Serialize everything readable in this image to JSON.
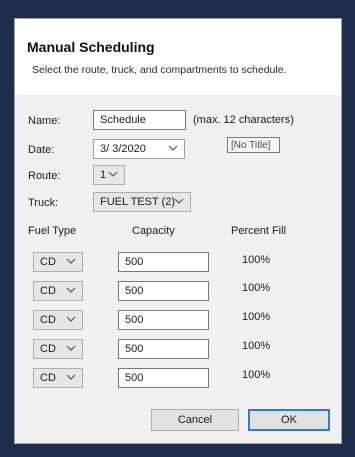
{
  "header": {
    "title": "Manual Scheduling",
    "subtitle": "Select the route, truck, and compartments to schedule."
  },
  "form": {
    "name_label": "Name:",
    "name_value": "Schedule",
    "name_hint": "(max. 12 characters)",
    "tooltip": "[No Title]",
    "date_label": "Date:",
    "date_value": "3/ 3/2020",
    "route_label": "Route:",
    "route_value": "1",
    "truck_label": "Truck:",
    "truck_value": "FUEL TEST (2)"
  },
  "table": {
    "headers": [
      "Fuel Type",
      "Capacity",
      "Percent Fill"
    ],
    "rows": [
      {
        "fuel_type": "CD",
        "capacity": "500",
        "percent_fill": "100%"
      },
      {
        "fuel_type": "CD",
        "capacity": "500",
        "percent_fill": "100%"
      },
      {
        "fuel_type": "CD",
        "capacity": "500",
        "percent_fill": "100%"
      },
      {
        "fuel_type": "CD",
        "capacity": "500",
        "percent_fill": "100%"
      },
      {
        "fuel_type": "CD",
        "capacity": "500",
        "percent_fill": "100%"
      }
    ]
  },
  "buttons": {
    "cancel": "Cancel",
    "ok": "OK"
  },
  "icons": {
    "dropdown": "chevron-down-icon"
  },
  "colors": {
    "background": "#1f2d4c",
    "dialog": "#f0f0f0",
    "header": "#ffffff",
    "ok_border": "#2f7bd6"
  }
}
